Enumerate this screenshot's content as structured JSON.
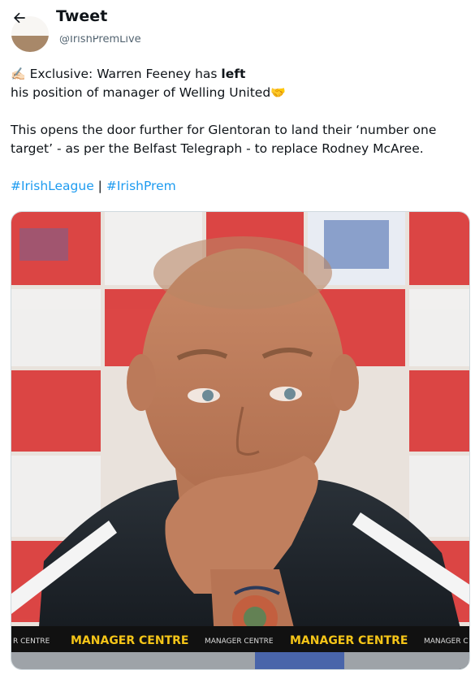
{
  "header": {
    "title": "Tweet"
  },
  "author": {
    "handle": "@IrishPremLive"
  },
  "tweet": {
    "line1_emoji": "✍🏻",
    "line1_prefix": "Exclusive: Warren Feeney has ",
    "line1_bold": "left",
    "line2_text": "his position of manager of Welling United",
    "line2_emoji": "🤝",
    "para2_line1": "This opens the door further for Glentoran to land their ‘number one",
    "para2_line2": "target’ - as per the Belfast Telegraph - to replace Rodney McAree.",
    "hashtag1": "#IrishLeague",
    "separator": "|",
    "hashtag2": "#IrishPrem"
  },
  "media": {
    "banner_small_1": "R CENTRE",
    "banner_big_1": "MANAGER CENTRE",
    "banner_small_2": "MANAGER CENTRE",
    "banner_big_2": "MANAGER CENTRE",
    "banner_small_3": "MANAGER C"
  },
  "colors": {
    "link": "#1d9bf0",
    "banner_yellow": "#f5c518",
    "backdrop_red": "#d92a2a"
  }
}
